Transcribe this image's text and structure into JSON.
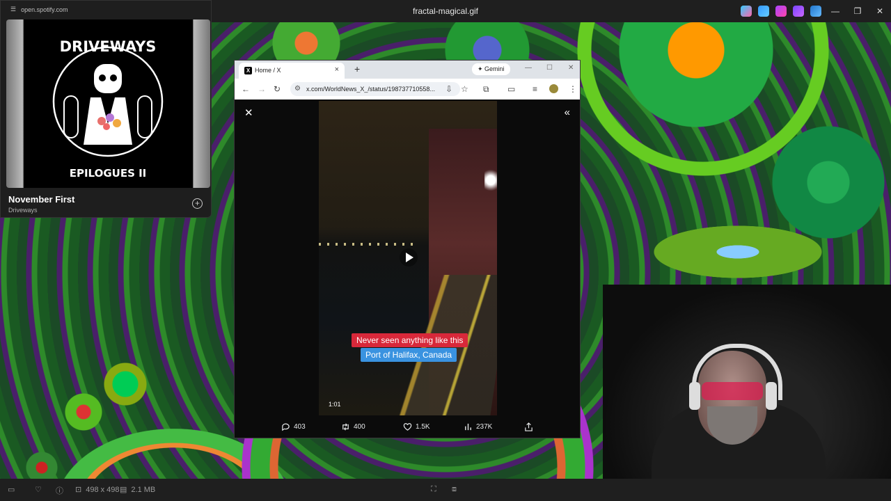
{
  "viewer": {
    "title": "fractal-magical.gif",
    "dimensions": "498 x 498",
    "file_size": "2.1 MB",
    "minimize": "—",
    "maximize": "❐",
    "close": "✕"
  },
  "spotify": {
    "url": "open.spotify.com",
    "album_top_text": "DRIVEWAYS",
    "album_bottom_text": "EPILOGUES II",
    "song_title": "November First",
    "artist": "Driveways"
  },
  "browser": {
    "tab_title": "Home / X",
    "gemini_label": "Gemini",
    "url": "x.com/WorldNews_X_/status/198737710558...",
    "minimize": "—",
    "maximize": "☐",
    "close": "✕"
  },
  "video": {
    "caption_line1": "Never seen anything like this",
    "caption_line2": "Port of Halifax, Canada",
    "time": "1:01"
  },
  "post_actions": {
    "replies": "403",
    "reposts": "400",
    "likes": "1.5K",
    "views": "237K"
  },
  "colors": {
    "caption_red": "#d8283a",
    "caption_blue": "#3a93e0",
    "viewer_bg": "#1f1f1f"
  }
}
